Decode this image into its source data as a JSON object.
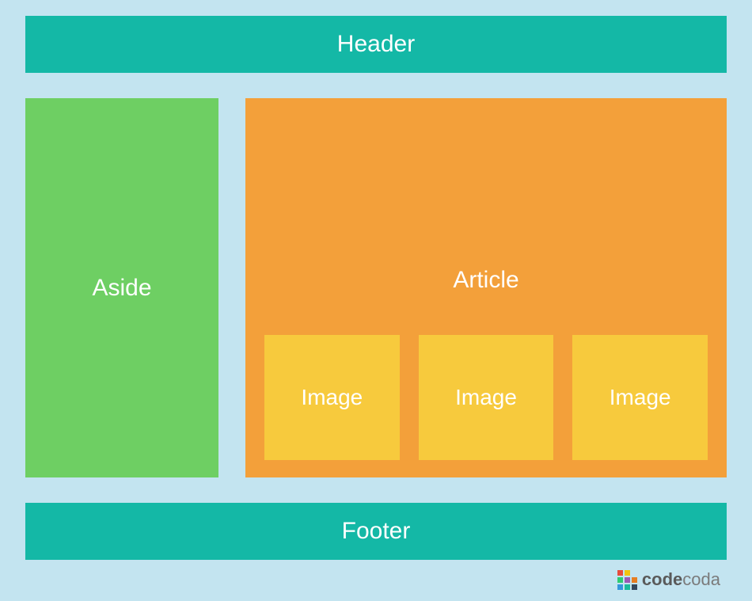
{
  "layout": {
    "header": "Header",
    "aside": "Aside",
    "article": "Article",
    "images": [
      "Image",
      "Image",
      "Image"
    ],
    "footer": "Footer"
  },
  "brand": {
    "name_bold": "code",
    "name_light": "coda"
  },
  "colors": {
    "page_bg": "#c3e4f0",
    "header_footer": "#14b8a6",
    "aside": "#6ecf63",
    "article": "#f3a03a",
    "image_box": "#f7ca3d",
    "text": "#ffffff"
  },
  "logo_colors": [
    "#e74c3c",
    "#f1c40f",
    "transparent",
    "#2ecc71",
    "#9b59b6",
    "#e67e22",
    "#3498db",
    "#1abc9c",
    "#34495e"
  ]
}
